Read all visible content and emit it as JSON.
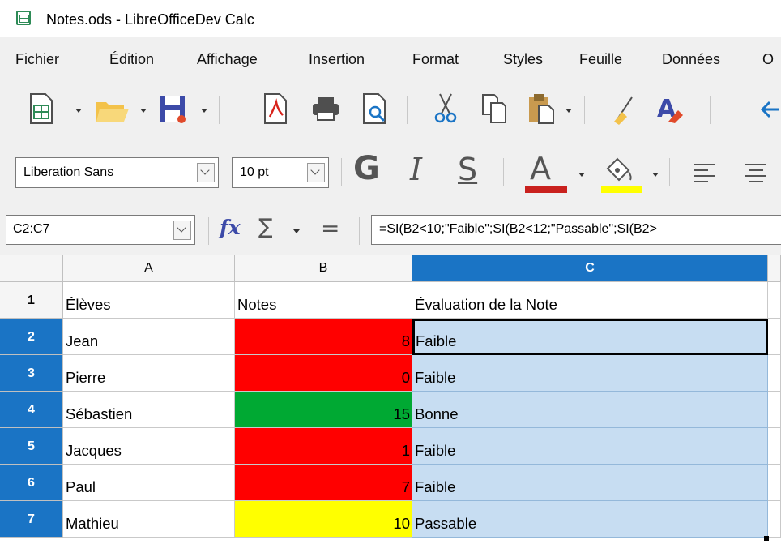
{
  "window": {
    "title": "Notes.ods - LibreOfficeDev Calc"
  },
  "menu": [
    "Fichier",
    "Édition",
    "Affichage",
    "Insertion",
    "Format",
    "Styles",
    "Feuille",
    "Données",
    "O"
  ],
  "toolbar": {
    "font_name": "Liberation Sans",
    "font_size": "10 pt",
    "bold": "G",
    "italic": "I",
    "underline": "S",
    "font_color_letter": "A",
    "font_color": "#c9211e",
    "highlight_color": "#ffff00"
  },
  "formula_bar": {
    "name_box": "C2:C7",
    "fx": "fx",
    "sum": "∑",
    "equals": "=",
    "formula": "=SI(B2<10;\"Faible\";SI(B2<12;\"Passable\";SI(B2>"
  },
  "sheet": {
    "columns": [
      "A",
      "B",
      "C"
    ],
    "rows": [
      {
        "num": "1",
        "a": "Élèves",
        "b": "Notes",
        "c": "Évaluation de la Note",
        "color": "#ffffff"
      },
      {
        "num": "2",
        "a": "Jean",
        "b": "8",
        "c": "Faible",
        "color": "#ff0000"
      },
      {
        "num": "3",
        "a": "Pierre",
        "b": "0",
        "c": "Faible",
        "color": "#ff0000"
      },
      {
        "num": "4",
        "a": "Sébastien",
        "b": "15",
        "c": "Bonne",
        "color": "#00a933"
      },
      {
        "num": "5",
        "a": "Jacques",
        "b": "1",
        "c": "Faible",
        "color": "#ff0000"
      },
      {
        "num": "6",
        "a": "Paul",
        "b": "7",
        "c": "Faible",
        "color": "#ff0000"
      },
      {
        "num": "7",
        "a": "Mathieu",
        "b": "10",
        "c": "Passable",
        "color": "#ffff00"
      }
    ],
    "selection_color": "#c7ddf2",
    "header_selected_color": "#1a74c5"
  }
}
